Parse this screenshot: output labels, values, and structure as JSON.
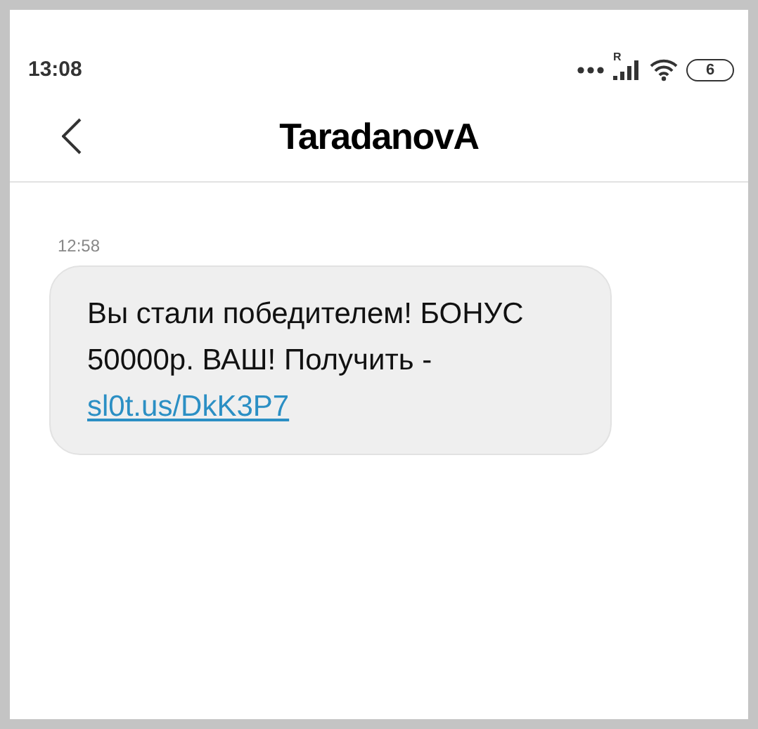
{
  "status_bar": {
    "time": "13:08",
    "roaming_mark": "R",
    "battery_level_text": "6"
  },
  "header": {
    "title": "TaradanovA"
  },
  "messages": [
    {
      "time": "12:58",
      "text": "Вы стали победителем! БОНУС 50000р. ВАШ! Получить - ",
      "link": "sl0t.us/DkK3P7"
    }
  ]
}
